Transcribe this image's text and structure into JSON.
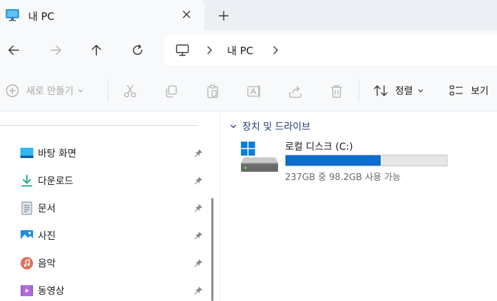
{
  "window": {
    "tab_title": "내 PC",
    "tab_icon": "computer-icon"
  },
  "address": {
    "path_label": "내 PC"
  },
  "toolbar": {
    "new_label": "새로 만들기",
    "sort_label": "정렬",
    "view_label": "보기"
  },
  "sidebar": {
    "items": [
      {
        "label": "바탕 화면",
        "icon": "desktop-icon"
      },
      {
        "label": "다운로드",
        "icon": "download-icon"
      },
      {
        "label": "문서",
        "icon": "document-icon"
      },
      {
        "label": "사진",
        "icon": "picture-icon"
      },
      {
        "label": "음악",
        "icon": "music-icon"
      },
      {
        "label": "동영상",
        "icon": "video-icon"
      }
    ]
  },
  "content": {
    "group_title": "장치 및 드라이브",
    "drive": {
      "name": "로컬 디스크 (C:)",
      "free_text": "237GB 중 98.2GB 사용 가능",
      "used_fraction": 0.59
    }
  },
  "colors": {
    "accent": "#0a6ecf",
    "group_title": "#1f3b73",
    "chrome_bg": "#f7f9fb",
    "titlebar_bg": "#eceff3"
  }
}
